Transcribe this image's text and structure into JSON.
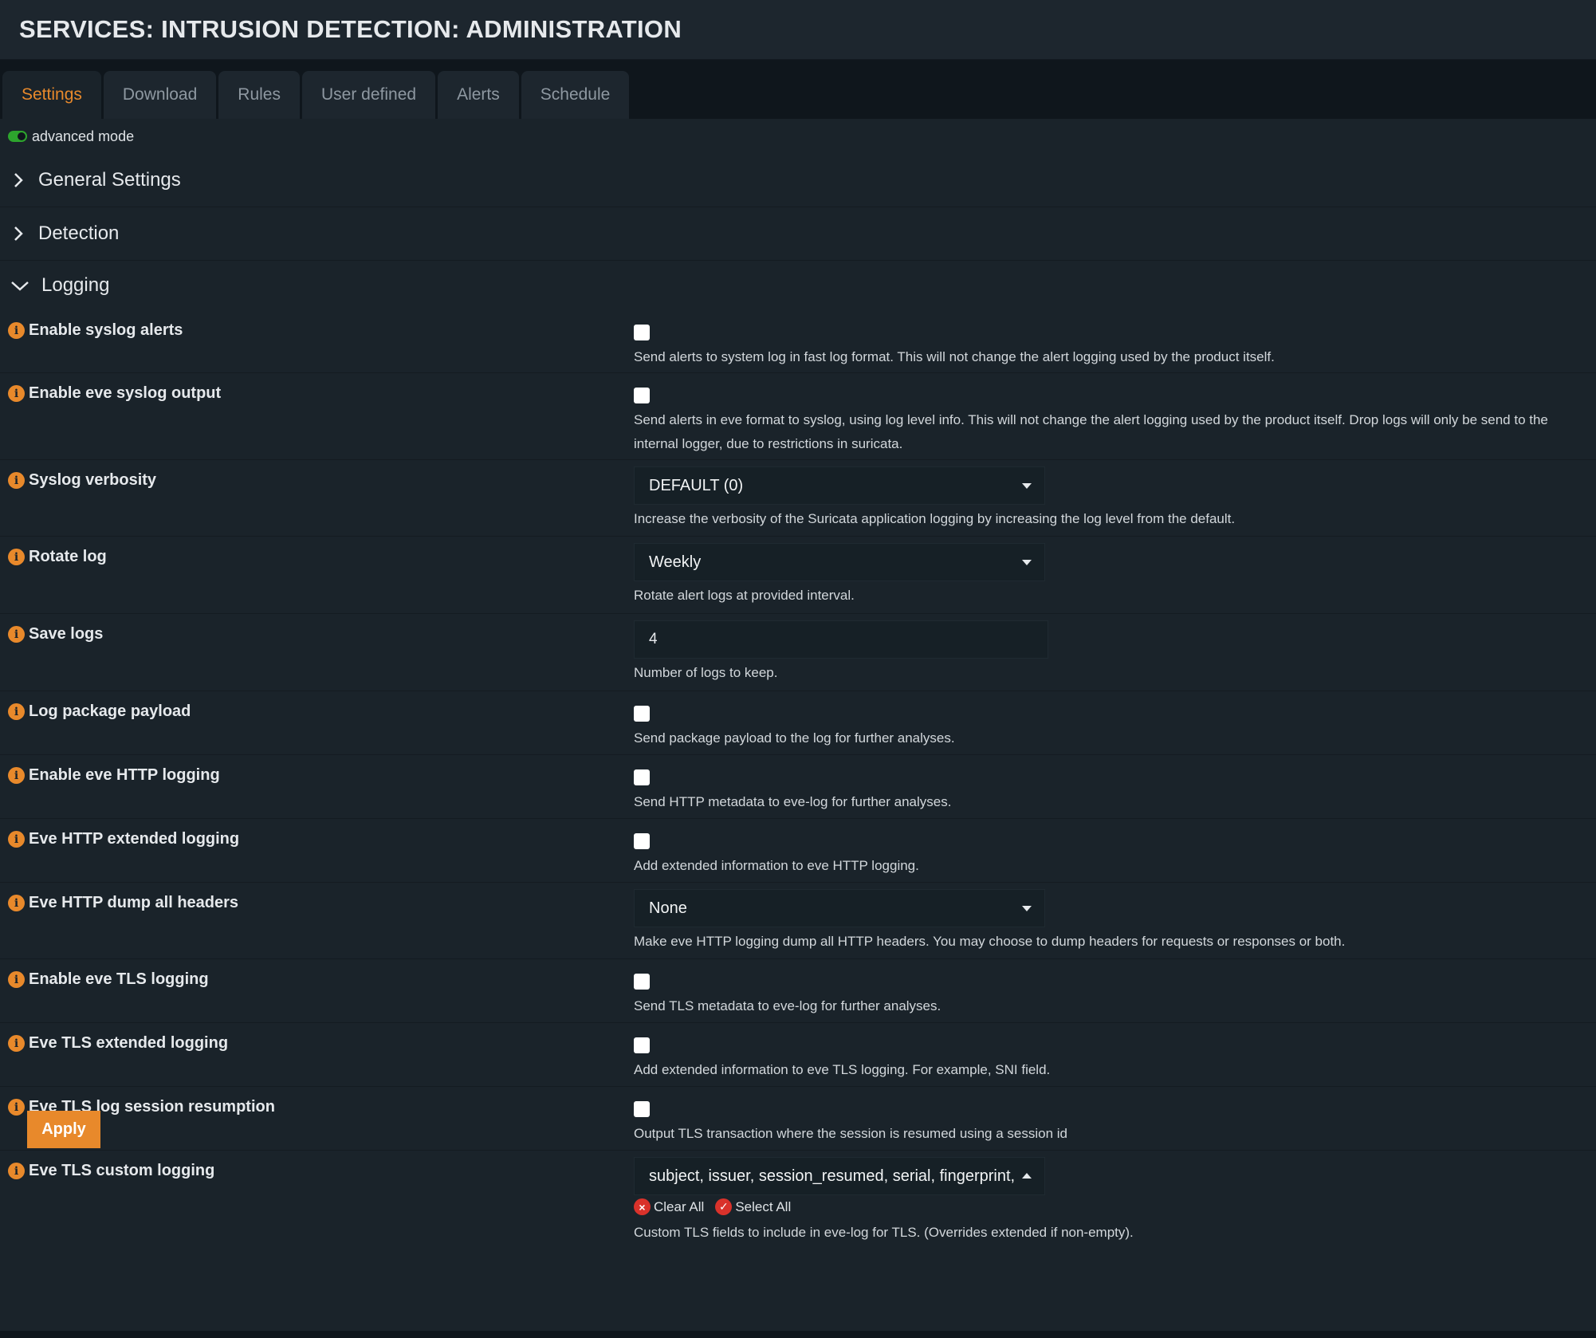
{
  "page": {
    "title": "SERVICES: INTRUSION DETECTION: ADMINISTRATION"
  },
  "tabs": [
    "Settings",
    "Download",
    "Rules",
    "User defined",
    "Alerts",
    "Schedule"
  ],
  "advanced_mode": {
    "label": "advanced mode",
    "enabled": true
  },
  "sections": {
    "general": "General Settings",
    "detection": "Detection",
    "logging": "Logging"
  },
  "fields": {
    "syslog_alerts": {
      "label": "Enable syslog alerts",
      "help": "Send alerts to system log in fast log format. This will not change the alert logging used by the product itself.",
      "checked": false
    },
    "eve_syslog": {
      "label": "Enable eve syslog output",
      "help": "Send alerts in eve format to syslog, using log level info. This will not change the alert logging used by the product itself. Drop logs will only be send to the internal logger, due to restrictions in suricata.",
      "checked": false
    },
    "syslog_verbosity": {
      "label": "Syslog verbosity",
      "value": "DEFAULT (0)",
      "help": "Increase the verbosity of the Suricata application logging by increasing the log level from the default."
    },
    "rotate_log": {
      "label": "Rotate log",
      "value": "Weekly",
      "help": "Rotate alert logs at provided interval."
    },
    "save_logs": {
      "label": "Save logs",
      "value": "4",
      "help": "Number of logs to keep."
    },
    "log_payload": {
      "label": "Log package payload",
      "help": "Send package payload to the log for further analyses.",
      "checked": false
    },
    "eve_http": {
      "label": "Enable eve HTTP logging",
      "help": "Send HTTP metadata to eve-log for further analyses.",
      "checked": false
    },
    "eve_http_ext": {
      "label": "Eve HTTP extended logging",
      "help": "Add extended information to eve HTTP logging.",
      "checked": false
    },
    "eve_http_dump": {
      "label": "Eve HTTP dump all headers",
      "value": "None",
      "help": "Make eve HTTP logging dump all HTTP headers. You may choose to dump headers for requests or responses or both."
    },
    "eve_tls": {
      "label": "Enable eve TLS logging",
      "help": "Send TLS metadata to eve-log for further analyses.",
      "checked": false
    },
    "eve_tls_ext": {
      "label": "Eve TLS extended logging",
      "help": "Add extended information to eve TLS logging. For example, SNI field.",
      "checked": false
    },
    "eve_tls_resume": {
      "label": "Eve TLS log session resumption",
      "help": "Output TLS transaction where the session is resumed using a session id",
      "checked": false
    },
    "eve_tls_custom": {
      "label": "Eve TLS custom logging",
      "value": "subject, issuer, session_resumed, serial, fingerprint, s",
      "clear_all": "Clear All",
      "select_all": "Select All",
      "help": "Custom TLS fields to include in eve-log for TLS. (Overrides extended if non-empty)."
    }
  },
  "actions": {
    "apply": "Apply"
  },
  "colors": {
    "accent": "#e8892b",
    "toggle_on": "#2da52d",
    "clear_icon": "#d9322b"
  }
}
